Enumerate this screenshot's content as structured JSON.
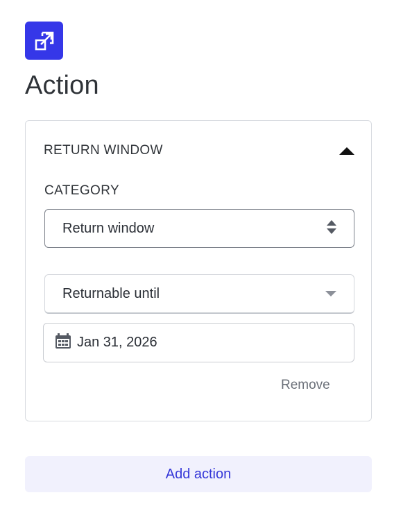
{
  "header": {
    "icon": "external-link-box-icon",
    "icon_color": "#3537e8",
    "title": "Action"
  },
  "section": {
    "title": "RETURN WINDOW",
    "expanded": true,
    "category_label": "CATEGORY",
    "category_value": "Return window",
    "condition_value": "Returnable until",
    "date_value": "Jan 31, 2026",
    "remove_label": "Remove"
  },
  "footer": {
    "add_action_label": "Add action",
    "accent": "#3537d8"
  }
}
